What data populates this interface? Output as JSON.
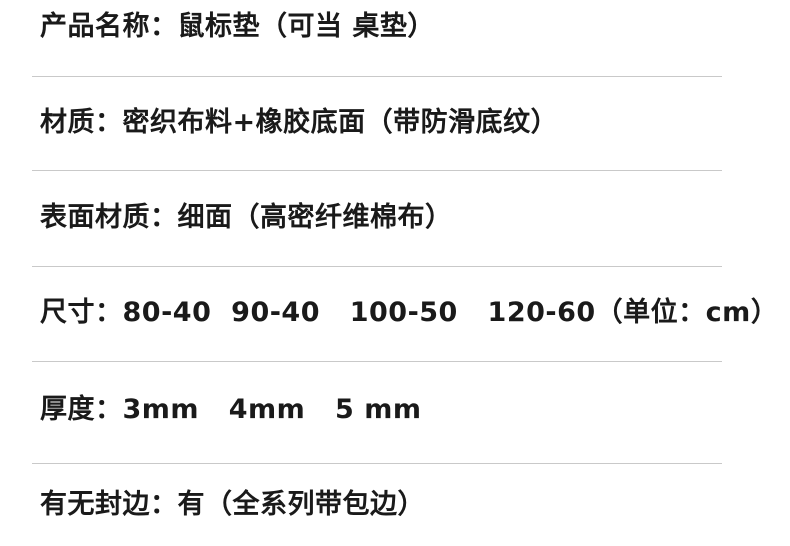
{
  "specs": [
    {
      "text": "产品名称：鼠标垫（可当 桌垫）"
    },
    {
      "text": "材质：密织布料+橡胶底面（带防滑底纹）"
    },
    {
      "text": "表面材质：细面（高密纤维棉布）"
    },
    {
      "text": "尺寸：80-40  90-40   100-50   120-60（单位：cm）"
    },
    {
      "text": "厚度：3mm   4mm   5 mm"
    },
    {
      "text": "有无封边：有（全系列带包边）"
    }
  ],
  "colors": {
    "text": "#1a1a1a",
    "divider": "#c9c9c9",
    "background": "#ffffff"
  }
}
